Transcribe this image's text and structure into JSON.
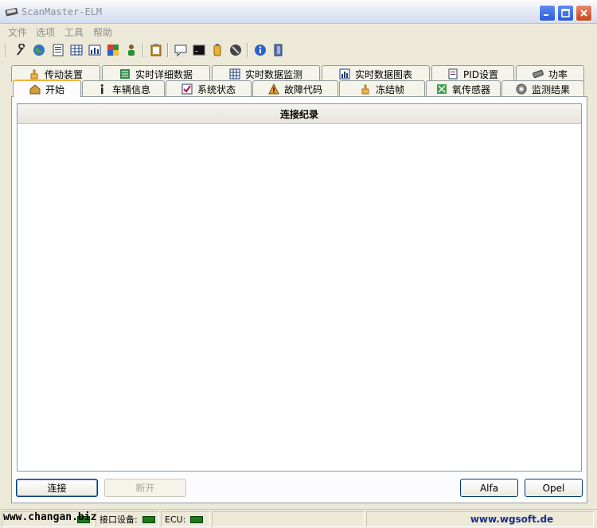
{
  "window": {
    "title": "ScanMaster-ELM"
  },
  "menu": [
    "文件",
    "选项",
    "工具",
    "帮助"
  ],
  "toolbar": {
    "icons": [
      "wrench-icon",
      "globe-icon",
      "document-icon",
      "grid-icon",
      "chart-icon",
      "puzzle-icon",
      "person-icon",
      "clipboard-icon",
      "comment-icon",
      "terminal-icon",
      "battery-icon",
      "stop-icon",
      "info-icon",
      "exit-icon"
    ]
  },
  "tabs_row1": [
    {
      "label": "传动装置",
      "icon": "hand-icon"
    },
    {
      "label": "实时详细数据",
      "icon": "list-icon"
    },
    {
      "label": "实时数据监测",
      "icon": "grid-icon"
    },
    {
      "label": "实时数据图表",
      "icon": "chart-icon"
    },
    {
      "label": "PID设置",
      "icon": "doc-icon"
    },
    {
      "label": "功率",
      "icon": "engine-icon"
    }
  ],
  "tabs_row2": [
    {
      "label": "开始",
      "icon": "home-icon",
      "active": true
    },
    {
      "label": "车辆信息",
      "icon": "info-icon"
    },
    {
      "label": "系统状态",
      "icon": "check-icon"
    },
    {
      "label": "故障代码",
      "icon": "warning-icon"
    },
    {
      "label": "冻结帧",
      "icon": "hand-icon"
    },
    {
      "label": "氧传感器",
      "icon": "sensor-icon"
    },
    {
      "label": "监测结果",
      "icon": "gear-icon"
    }
  ],
  "log": {
    "header": "连接纪录"
  },
  "buttons": {
    "connect": "连接",
    "disconnect": "断开",
    "alfa": "Alfa",
    "opel": "Opel"
  },
  "status": {
    "interface_label": "接口设备:",
    "ecu_label": "ECU:",
    "website": "www.wgsoft.de",
    "watermark": "www.changan.biz"
  }
}
